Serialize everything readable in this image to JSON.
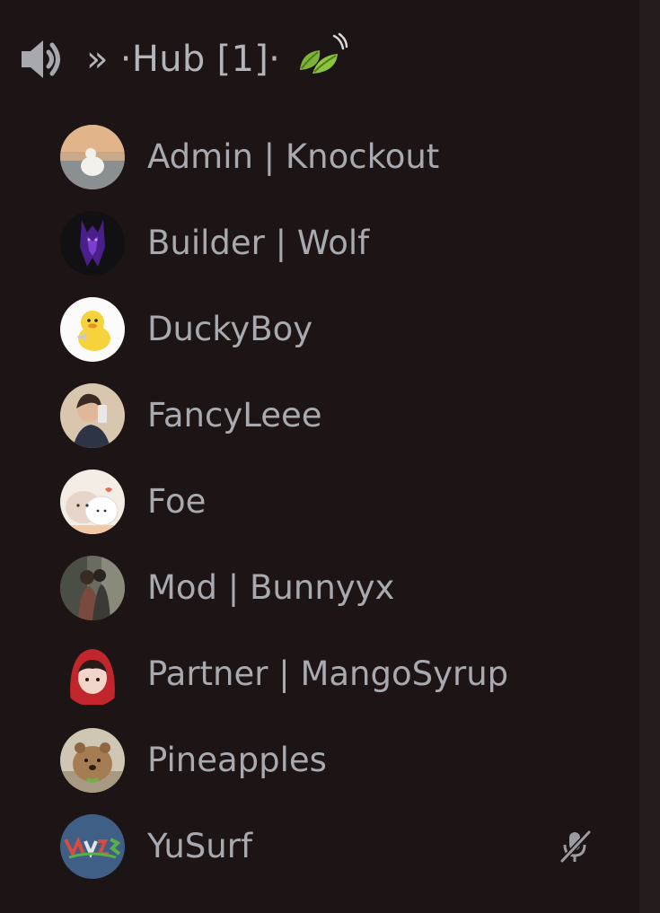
{
  "channel": {
    "prefix": "» · ",
    "name": "Hub [1]",
    "suffix": " · ",
    "icon": "speaker-icon",
    "emoji": "leaves-emoji"
  },
  "members": [
    {
      "name": "Admin | Knockout",
      "avatar": "duck-photo-avatar"
    },
    {
      "name": "Builder | Wolf",
      "avatar": "purple-wolf-avatar"
    },
    {
      "name": "DuckyBoy",
      "avatar": "cartoon-duck-avatar"
    },
    {
      "name": "FancyLeee",
      "avatar": "selfie-avatar"
    },
    {
      "name": "Foe",
      "avatar": "cartoon-cats-avatar"
    },
    {
      "name": "Mod | Bunnyyx",
      "avatar": "couple-photo-avatar"
    },
    {
      "name": "Partner | MangoSyrup",
      "avatar": "red-hood-avatar"
    },
    {
      "name": "Pineapples",
      "avatar": "quokka-avatar"
    },
    {
      "name": "YuSurf",
      "avatar": "graffiti-avatar",
      "muted": true,
      "status_icon": "muted-mic-icon"
    }
  ],
  "colors": {
    "background": "#1c1415",
    "text": "#a8aaaf",
    "icon": "#9a9ca1"
  }
}
